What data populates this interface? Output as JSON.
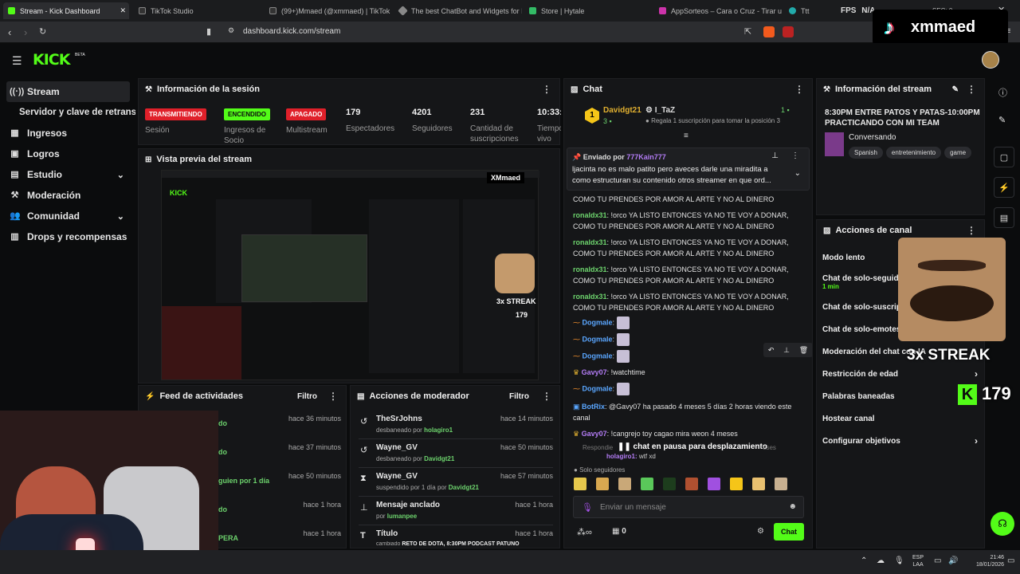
{
  "browser": {
    "tabs": [
      {
        "label": "Stream - Kick Dashboard",
        "fav": "#53fc18"
      },
      {
        "label": "TikTok Studio",
        "fav": "#111"
      },
      {
        "label": "(99+)Mmaed (@xmmaed) | TikTok",
        "fav": "#111"
      },
      {
        "label": "The best ChatBot and Widgets for Ki",
        "fav": "#777"
      },
      {
        "label": "Store | Hytale",
        "fav": "#3b6"
      },
      {
        "label": "AppSorteos – Cara o Cruz - Tirar una",
        "fav": "#c3a"
      },
      {
        "label": "Ttt",
        "fav": "#2aa"
      }
    ],
    "url": "dashboard.kick.com/stream",
    "fps_label": "FPS",
    "fps_value": "N/A",
    "fps_extra": "SEC:  0"
  },
  "overlay": {
    "tiktok_handle": "xmmaed",
    "streak_label": "3x STREAK",
    "streak_count": "179"
  },
  "kick": {
    "logo": "KICK",
    "logo_sup": "BETA"
  },
  "sidebar": {
    "items": [
      {
        "label": "Stream",
        "icon": "broadcast-icon"
      },
      {
        "label": "Servidor y clave de retransm",
        "icon": ""
      },
      {
        "label": "Ingresos",
        "icon": "revenue-icon"
      },
      {
        "label": "Logros",
        "icon": "achievements-icon"
      },
      {
        "label": "Estudio",
        "icon": "studio-icon"
      },
      {
        "label": "Moderación",
        "icon": "moderation-icon"
      },
      {
        "label": "Comunidad",
        "icon": "community-icon"
      },
      {
        "label": "Drops y recompensas",
        "icon": "drops-icon"
      }
    ]
  },
  "session": {
    "title": "Información de la sesión",
    "badges": [
      {
        "text": "TRANSMITIENDO",
        "label": "Sesión",
        "color": "#e0202a"
      },
      {
        "text": "ENCENDIDO",
        "label": "Ingresos de Socio",
        "color": "#53fc18"
      },
      {
        "text": "APAGADO",
        "label": "Multistream",
        "color": "#e0202a"
      }
    ],
    "stats": [
      {
        "value": "179",
        "label": "Espectadores"
      },
      {
        "value": "4201",
        "label": "Seguidores"
      },
      {
        "value": "231",
        "label": "Cantidad de suscripciones"
      },
      {
        "value": "10:33:",
        "label": "Tiempo en vivo"
      }
    ]
  },
  "preview": {
    "title": "Vista previa del stream",
    "mini_handle": "XMmaed",
    "mini_streak": "3x STREAK",
    "mini_count": "179"
  },
  "feed": {
    "title": "Feed de actividades",
    "filter": "Filtro",
    "rows": [
      {
        "text": "do",
        "time": "hace 36 minutos"
      },
      {
        "text": "do",
        "time": "hace 37 minutos"
      },
      {
        "text": "guien por 1 día",
        "time": "hace 50 minutos"
      },
      {
        "text": "do",
        "time": "hace 1 hora"
      },
      {
        "text": "PERA",
        "time": "hace 1 hora"
      }
    ]
  },
  "modactions": {
    "title": "Acciones de moderador",
    "filter": "Filtro",
    "rows": [
      {
        "name": "TheSrJohns",
        "action": "desbaneado por",
        "by": "holagiro1",
        "time": "hace 14 minutos",
        "icon": "undo-icon"
      },
      {
        "name": "Wayne_GV",
        "action": "desbaneado por",
        "by": "Davidgt21",
        "time": "hace 50 minutos",
        "icon": "undo-icon"
      },
      {
        "name": "Wayne_GV",
        "action": "suspendido por 1 día por",
        "by": "Davidgt21",
        "time": "hace 57 minutos",
        "icon": "hourglass-icon"
      },
      {
        "name": "Mensaje anclado",
        "action": "por",
        "by": "lumanpee",
        "time": "hace 1 hora",
        "icon": "pin-icon"
      },
      {
        "name": "Título",
        "action": "cambiado",
        "by": "RETO DE DOTA, 8:30PM PODCAST PATUNO",
        "time": "hace 1 hora",
        "icon": "title-icon"
      }
    ]
  },
  "chat": {
    "title": "Chat",
    "top_user": "Davidgt21",
    "top_count": "3",
    "second_user": "I_TaZ",
    "second_count": "1",
    "gift_text": "Regala 1 suscripción para tomar la posición 3",
    "pinned_label": "Enviado por",
    "pinned_user": "777Kain777",
    "pinned_text": "ljacinta no es malo patito pero aveces darle una miradita a como estructuran su contenido otros streamer en que ord...",
    "messages": [
      {
        "user": "",
        "text": "COMO TU PRENDES POR AMOR AL ARTE Y NO AL DINERO",
        "cls": ""
      },
      {
        "user": "ronaldx31",
        "text": "!orco YA LISTO ENTONCES YA NO TE VOY A DONAR, COMO TU PRENDES POR AMOR AL ARTE Y NO AL DINERO",
        "cls": "u-green"
      },
      {
        "user": "ronaldx31",
        "text": "!orco YA LISTO ENTONCES YA NO TE VOY A DONAR, COMO TU PRENDES POR AMOR AL ARTE Y NO AL DINERO",
        "cls": "u-green"
      },
      {
        "user": "ronaldx31",
        "text": "!orco YA LISTO ENTONCES YA NO TE VOY A DONAR, COMO TU PRENDES POR AMOR AL ARTE Y NO AL DINERO",
        "cls": "u-green"
      },
      {
        "user": "ronaldx31",
        "text": "!orco YA LISTO ENTONCES YA NO TE VOY A DONAR, COMO TU PRENDES POR AMOR AL ARTE Y NO AL DINERO",
        "cls": "u-green"
      }
    ],
    "emote_user": "Dogmale",
    "gavy_user": "Gavy07",
    "gavy_text": "!watchtime",
    "bot_user": "BotRix",
    "bot_text": "@Gavy07 ha pasado 4 meses 5 días 2 horas viendo este canal",
    "gavy2_text": "!cangrejo toy cagao mira weon 4 meses",
    "reply_label": "Respondie",
    "paused": "chat en pausa para desplazamiento",
    "paused_tail": "eses",
    "last_user": "holagiro1",
    "last_text": "wtf xd",
    "followers_only": "Solo seguidores",
    "input_placeholder": "Enviar un mensaje",
    "loop_count": "0",
    "send": "Chat"
  },
  "streaminfo": {
    "title": "Información del stream",
    "stream_title": "8:30PM ENTRE PATOS Y PATAS-10:00PM PRACTICANDO CON MI TEAM",
    "category": "Conversando",
    "tags": [
      "Spanish",
      "entretenimiento",
      "game"
    ]
  },
  "channel": {
    "title": "Acciones de canal",
    "rows": [
      {
        "label": "Modo lento",
        "sub": "",
        "chev": false
      },
      {
        "label": "Chat de solo-seguido",
        "sub": "1 min",
        "chev": false
      },
      {
        "label": "Chat de solo-suscript",
        "sub": "",
        "chev": false
      },
      {
        "label": "Chat de solo-emotes",
        "sub": "",
        "chev": false
      },
      {
        "label": "Moderación del chat con IA",
        "sub": "",
        "chev": false
      },
      {
        "label": "Restricción de edad",
        "sub": "",
        "chev": true
      },
      {
        "label": "Palabras baneadas",
        "sub": "",
        "chev": false
      },
      {
        "label": "Hostear canal",
        "sub": "",
        "chev": false
      },
      {
        "label": "Configurar objetivos",
        "sub": "",
        "chev": true
      }
    ]
  },
  "taskbar": {
    "lang": "ESP",
    "lang2": "LAA",
    "time": "21:46",
    "date": "18/01/2026"
  }
}
